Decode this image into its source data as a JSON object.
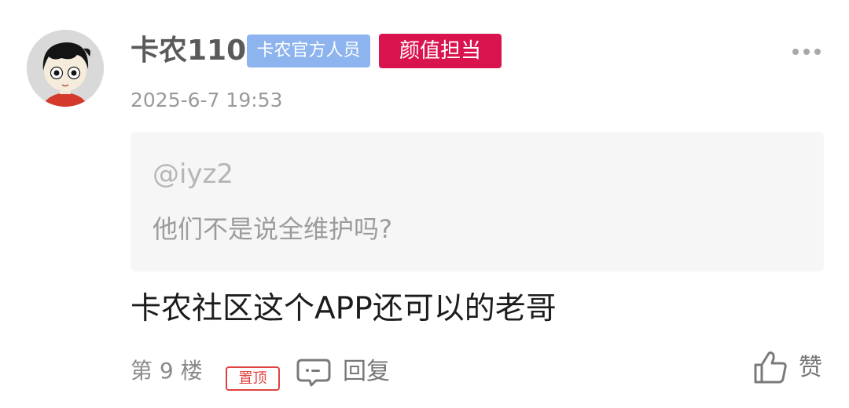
{
  "comment": {
    "author": {
      "name": "卡农110",
      "badges": [
        "卡农官方人员",
        "颜值担当"
      ],
      "avatar": "cartoon-boy-avatar"
    },
    "timestamp": "2025-6-7 19:53",
    "quote": {
      "user": "@iyz2",
      "text": "他们不是说全维护吗?"
    },
    "body": "卡农社区这个APP还可以的老哥",
    "floor": "第 9 楼",
    "pinned_label": "置顶",
    "reply_label": "回复",
    "like_label": "赞",
    "more_icon": "more-dots-icon"
  },
  "colors": {
    "official_badge": "#8db4ee",
    "honor_badge": "#d9134d",
    "pin_red": "#e0413f",
    "quote_bg": "#f6f6f6"
  }
}
